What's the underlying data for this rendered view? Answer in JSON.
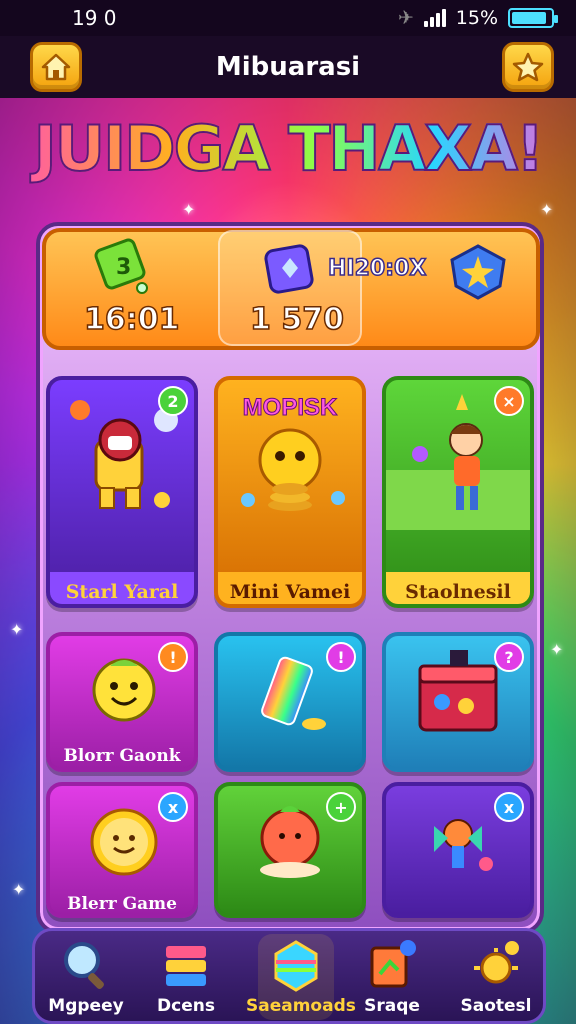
{
  "status_bar": {
    "time": "19 0",
    "battery_text": "15%",
    "battery_level": 0.9
  },
  "header": {
    "title": "Mibuarasi",
    "left_icon": "home-icon",
    "right_icon": "star-icon"
  },
  "banner_title": "JUIDGA THAXA!",
  "stats": {
    "left_value": "16:01",
    "mid_value": "1 570",
    "mid_label": "HI20:0X",
    "left_icon": "green-gem-icon",
    "mid_icon": "purple-gem-icon",
    "right_icon": "shield-star-icon"
  },
  "cards": [
    {
      "label": "Starl Yaral",
      "badge": "2",
      "theme": "#7b3dff",
      "border": "#4a1ea0"
    },
    {
      "label": "Mini Vamei",
      "top_title": "MOPISK",
      "badge": "",
      "theme": "#ffb21f",
      "border": "#d46a00"
    },
    {
      "label": "Staolnesil",
      "badge": "×",
      "theme": "#5ed63a",
      "border": "#2d8a16"
    },
    {
      "label": "Blorr Gaonk",
      "badge": "!",
      "theme": "#e13ce6",
      "border": "#9c1fa6"
    },
    {
      "label": "",
      "badge": "!",
      "theme": "#29c2ef",
      "border": "#1377a8"
    },
    {
      "label": "",
      "badge": "?",
      "theme": "#3ac3ef",
      "border": "#1f7fb8"
    },
    {
      "label": "Blerr Game",
      "badge": "x",
      "theme": "#e13ce6",
      "border": "#9c1fa6"
    },
    {
      "label": "",
      "badge": "+",
      "theme": "#61d23a",
      "border": "#2d8a16"
    },
    {
      "label": "",
      "badge": "x",
      "theme": "#7a3ddf",
      "border": "#4a1ea0"
    }
  ],
  "nav": [
    {
      "label": "Mgpeey",
      "icon": "magnifier-icon"
    },
    {
      "label": "Dcens",
      "icon": "stack-icon"
    },
    {
      "label": "Saeamoads",
      "icon": "rainbow-box-icon",
      "active": true
    },
    {
      "label": "Sraqe",
      "icon": "flag-board-icon"
    },
    {
      "label": "Saotesl",
      "icon": "sun-icon"
    }
  ]
}
